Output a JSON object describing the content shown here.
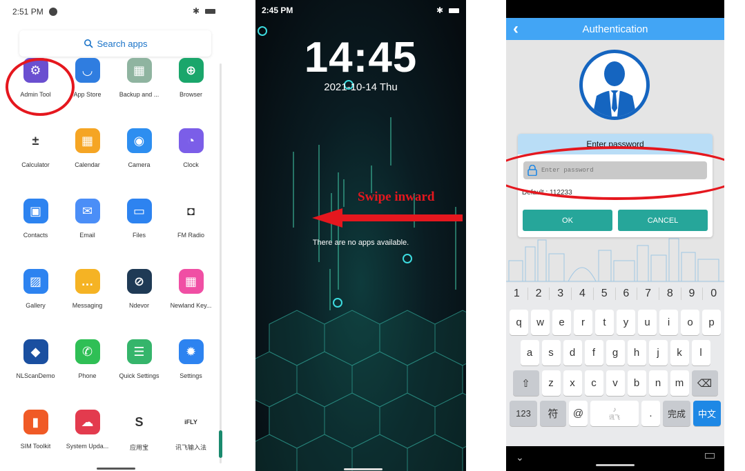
{
  "panel1": {
    "status_time": "2:51 PM",
    "search_label": "Search apps",
    "apps": [
      {
        "label": "Admin Tool",
        "color": "#6a4fd0",
        "glyph": "⚙"
      },
      {
        "label": "App Store",
        "color": "#2f7de0",
        "glyph": "◡"
      },
      {
        "label": "Backup and ...",
        "color": "#8fb4a0",
        "glyph": "▦"
      },
      {
        "label": "Browser",
        "color": "#1aa66b",
        "glyph": "⊕"
      },
      {
        "label": "Calculator",
        "color": "#ffffff",
        "glyph": "±"
      },
      {
        "label": "Calendar",
        "color": "#f5a524",
        "glyph": "▦"
      },
      {
        "label": "Camera",
        "color": "#2d8ef0",
        "glyph": "◉"
      },
      {
        "label": "Clock",
        "color": "#7b5ee8",
        "glyph": "◔"
      },
      {
        "label": "Contacts",
        "color": "#2d83f0",
        "glyph": "▣"
      },
      {
        "label": "Email",
        "color": "#4b8ef7",
        "glyph": "✉"
      },
      {
        "label": "Files",
        "color": "#2d83f0",
        "glyph": "▭"
      },
      {
        "label": "FM Radio",
        "color": "#ffffff",
        "glyph": "◘"
      },
      {
        "label": "Gallery",
        "color": "#2d83f0",
        "glyph": "▨"
      },
      {
        "label": "Messaging",
        "color": "#f5b324",
        "glyph": "…"
      },
      {
        "label": "Ndevor",
        "color": "#1f3a55",
        "glyph": "⊘"
      },
      {
        "label": "Newland Key...",
        "color": "#f04fa4",
        "glyph": "▦"
      },
      {
        "label": "NLScanDemo",
        "color": "#1a4fa0",
        "glyph": "◆"
      },
      {
        "label": "Phone",
        "color": "#2fbf55",
        "glyph": "✆"
      },
      {
        "label": "Quick Settings",
        "color": "#35b56b",
        "glyph": "☰"
      },
      {
        "label": "Settings",
        "color": "#2d83f0",
        "glyph": "✹"
      },
      {
        "label": "SIM Toolkit",
        "color": "#f05a26",
        "glyph": "▮"
      },
      {
        "label": "System Upda...",
        "color": "#e33b4e",
        "glyph": "☁"
      },
      {
        "label": "应用宝",
        "color": "#ffffff",
        "glyph": "S"
      },
      {
        "label": "讯飞输入法",
        "color": "#ffffff",
        "glyph": "iFLY"
      }
    ]
  },
  "panel2": {
    "status_time": "2:45 PM",
    "clock": "14:45",
    "date": "2021-10-14 Thu",
    "swipe_label": "Swipe inward",
    "no_apps": "There are no apps available."
  },
  "panel3": {
    "title": "Authentication",
    "dialog_title": "Enter password",
    "password_placeholder": "Enter password",
    "default_hint": "Default : 112233",
    "ok_label": "OK",
    "cancel_label": "CANCEL",
    "keyboard": {
      "numbers": [
        "1",
        "2",
        "3",
        "4",
        "5",
        "6",
        "7",
        "8",
        "9",
        "0"
      ],
      "row1": [
        "q",
        "w",
        "e",
        "r",
        "t",
        "y",
        "u",
        "i",
        "o",
        "p"
      ],
      "row2": [
        "a",
        "s",
        "d",
        "f",
        "g",
        "h",
        "j",
        "k",
        "l"
      ],
      "row3": [
        "z",
        "x",
        "c",
        "v",
        "b",
        "n",
        "m"
      ],
      "shift": "⇧",
      "backspace": "⌫",
      "mode_123": "123",
      "symbols": "符",
      "at": "@",
      "space_hint": "讯飞",
      "period": ".",
      "done": "完成",
      "lang": "中文",
      "collapse": "⌄"
    }
  }
}
